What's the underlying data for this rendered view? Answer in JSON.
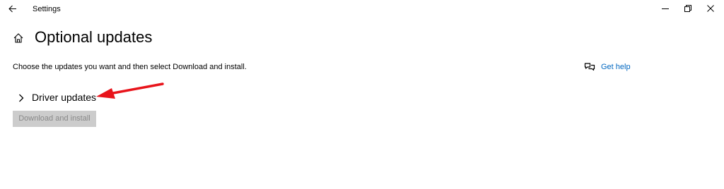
{
  "window": {
    "app_title": "Settings",
    "back_icon": "back-arrow-icon",
    "controls": [
      "minimize-icon",
      "restore-icon",
      "close-icon"
    ]
  },
  "page": {
    "title": "Optional updates",
    "home_icon": "home-icon",
    "description": "Choose the updates you want and then select Download and install."
  },
  "help": {
    "label": "Get help",
    "icon": "chat-help-icon"
  },
  "sections": [
    {
      "label": "Driver updates",
      "expanded": false,
      "icon": "chevron-right-icon"
    }
  ],
  "actions": {
    "download_install_label": "Download and install",
    "download_install_enabled": false
  },
  "annotation": {
    "type": "red-arrow",
    "points_to": "Driver updates",
    "color": "#e8141b"
  },
  "colors": {
    "link": "#0067c0",
    "disabled_button_bg": "#cccccc",
    "disabled_button_text": "#888888"
  }
}
